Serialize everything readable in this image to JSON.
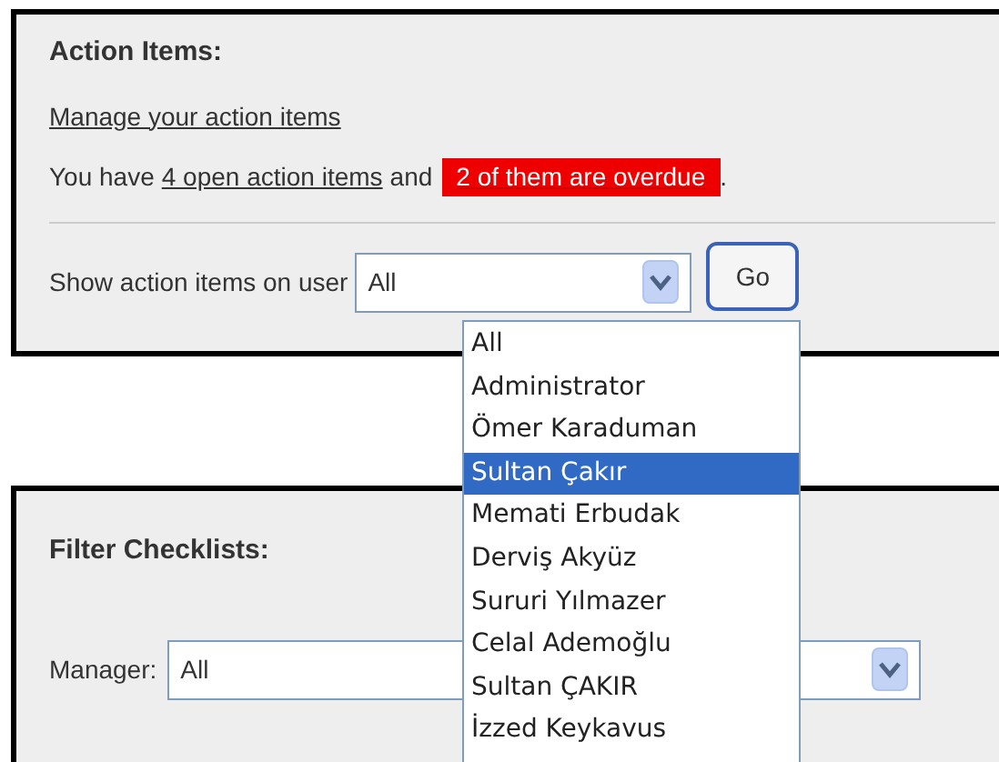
{
  "action_items": {
    "title": "Action Items:",
    "manage_link": "Manage your action items",
    "summary_prefix": "You have",
    "open_link": "4 open action items",
    "summary_middle": "and",
    "overdue_badge": "2 of them are overdue",
    "summary_end": ".",
    "user_label": "Show action items on user",
    "user_select": {
      "value": "All",
      "expanded": true
    },
    "go_button": "Go"
  },
  "user_options": [
    {
      "label": "All",
      "selected": false
    },
    {
      "label": "Administrator",
      "selected": false
    },
    {
      "label": "Ömer Karaduman",
      "selected": false
    },
    {
      "label": "Sultan Çakır",
      "selected": true
    },
    {
      "label": "Memati Erbudak",
      "selected": false
    },
    {
      "label": "Derviş Akyüz",
      "selected": false
    },
    {
      "label": "Sururi Yılmazer",
      "selected": false
    },
    {
      "label": "Celal Ademoğlu",
      "selected": false
    },
    {
      "label": "Sultan ÇAKIR",
      "selected": false
    },
    {
      "label": "İzzed Keykavus",
      "selected": false
    }
  ],
  "filter_checklists": {
    "title": "Filter Checklists:",
    "manager_label": "Manager:",
    "manager_select": {
      "value": "All"
    }
  }
}
